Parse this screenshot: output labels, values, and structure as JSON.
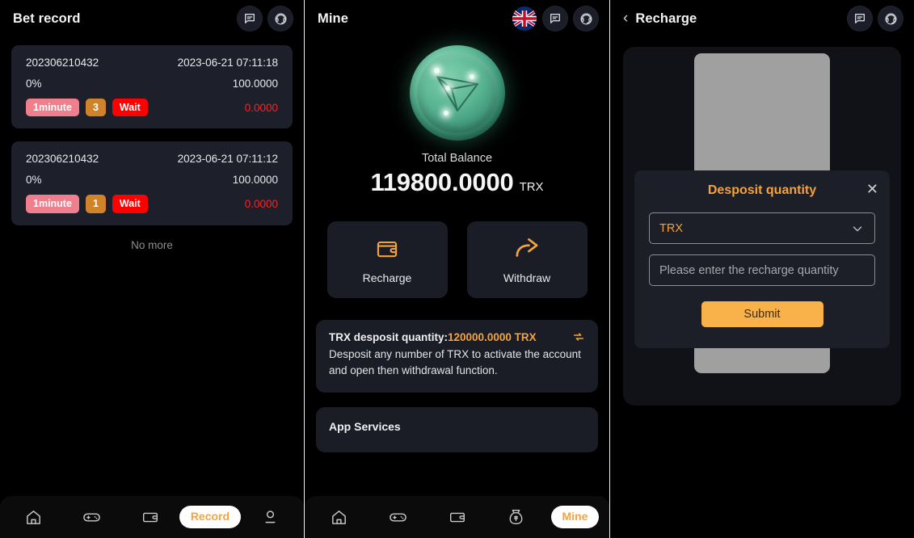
{
  "colors": {
    "page_bg": "#000000",
    "card_bg": "#1d1f2a",
    "accent_orange": "#f5a33c",
    "submit_orange": "#f9b14a",
    "tag_period_pink": "#ef7f8d",
    "tag_number_orange": "#d1832a",
    "tag_state_red": "#fe0000",
    "result_red": "#fe2020",
    "coin_green": "#58b492",
    "qr_placeholder_gray": "#a0a0a0",
    "divider_white": "#f2f2f2"
  },
  "panel_bet_record": {
    "header": {
      "title": "Bet record",
      "icons": [
        "chat-icon",
        "support-headset-icon"
      ]
    },
    "records": [
      {
        "id": "202306210432",
        "time": "2023-06-21 07:11:18",
        "percent": "0%",
        "amount": "100.0000",
        "period_tag": "1minute",
        "number_tag": "3",
        "state_tag": "Wait",
        "result": "0.0000"
      },
      {
        "id": "202306210432",
        "time": "2023-06-21 07:11:12",
        "percent": "0%",
        "amount": "100.0000",
        "period_tag": "1minute",
        "number_tag": "1",
        "state_tag": "Wait",
        "result": "0.0000"
      }
    ],
    "footer_text": "No more",
    "tabbar": {
      "items": [
        {
          "name": "home-icon",
          "label": "",
          "active": false
        },
        {
          "name": "gamepad-icon",
          "label": "",
          "active": false
        },
        {
          "name": "wallet-icon",
          "label": "",
          "active": false
        },
        {
          "name": "record-tab",
          "label": "Record",
          "active": true
        },
        {
          "name": "user-icon",
          "label": "",
          "active": false
        }
      ]
    }
  },
  "panel_mine": {
    "header": {
      "title": "Mine",
      "icons": [
        "uk-flag-icon",
        "chat-icon",
        "support-headset-icon"
      ]
    },
    "coin": {
      "name": "tron-coin-icon"
    },
    "balance_label": "Total Balance",
    "balance_value": "119800.0000",
    "balance_unit": "TRX",
    "actions": [
      {
        "icon": "wallet-icon",
        "label": "Recharge"
      },
      {
        "icon": "share-arrow-icon",
        "label": "Withdraw"
      }
    ],
    "notice": {
      "title": "TRX desposit quantity:",
      "amount": "120000.0000 TRX",
      "body": "Desposit any number of TRX to activate the account and open then withdrawal function.",
      "refresh_icon": "refresh-icon"
    },
    "services_title": "App Services",
    "tabbar": {
      "items": [
        {
          "name": "home-icon",
          "label": "",
          "active": false
        },
        {
          "name": "gamepad-icon",
          "label": "",
          "active": false
        },
        {
          "name": "wallet-icon",
          "label": "",
          "active": false
        },
        {
          "name": "money-bag-icon",
          "label": "",
          "active": false
        },
        {
          "name": "mine-tab",
          "label": "Mine",
          "active": true
        }
      ]
    }
  },
  "panel_recharge": {
    "header": {
      "back_icon": "chevron-left-icon",
      "title": "Recharge",
      "icons": [
        "chat-icon",
        "support-headset-icon"
      ]
    },
    "modal": {
      "title": "Desposit quantity",
      "close_icon": "close-icon",
      "currency_value": "TRX",
      "currency_caret": "chevron-down-icon",
      "amount_placeholder": "Please enter the recharge quantity",
      "amount_value": "",
      "submit_label": "Submit"
    }
  }
}
